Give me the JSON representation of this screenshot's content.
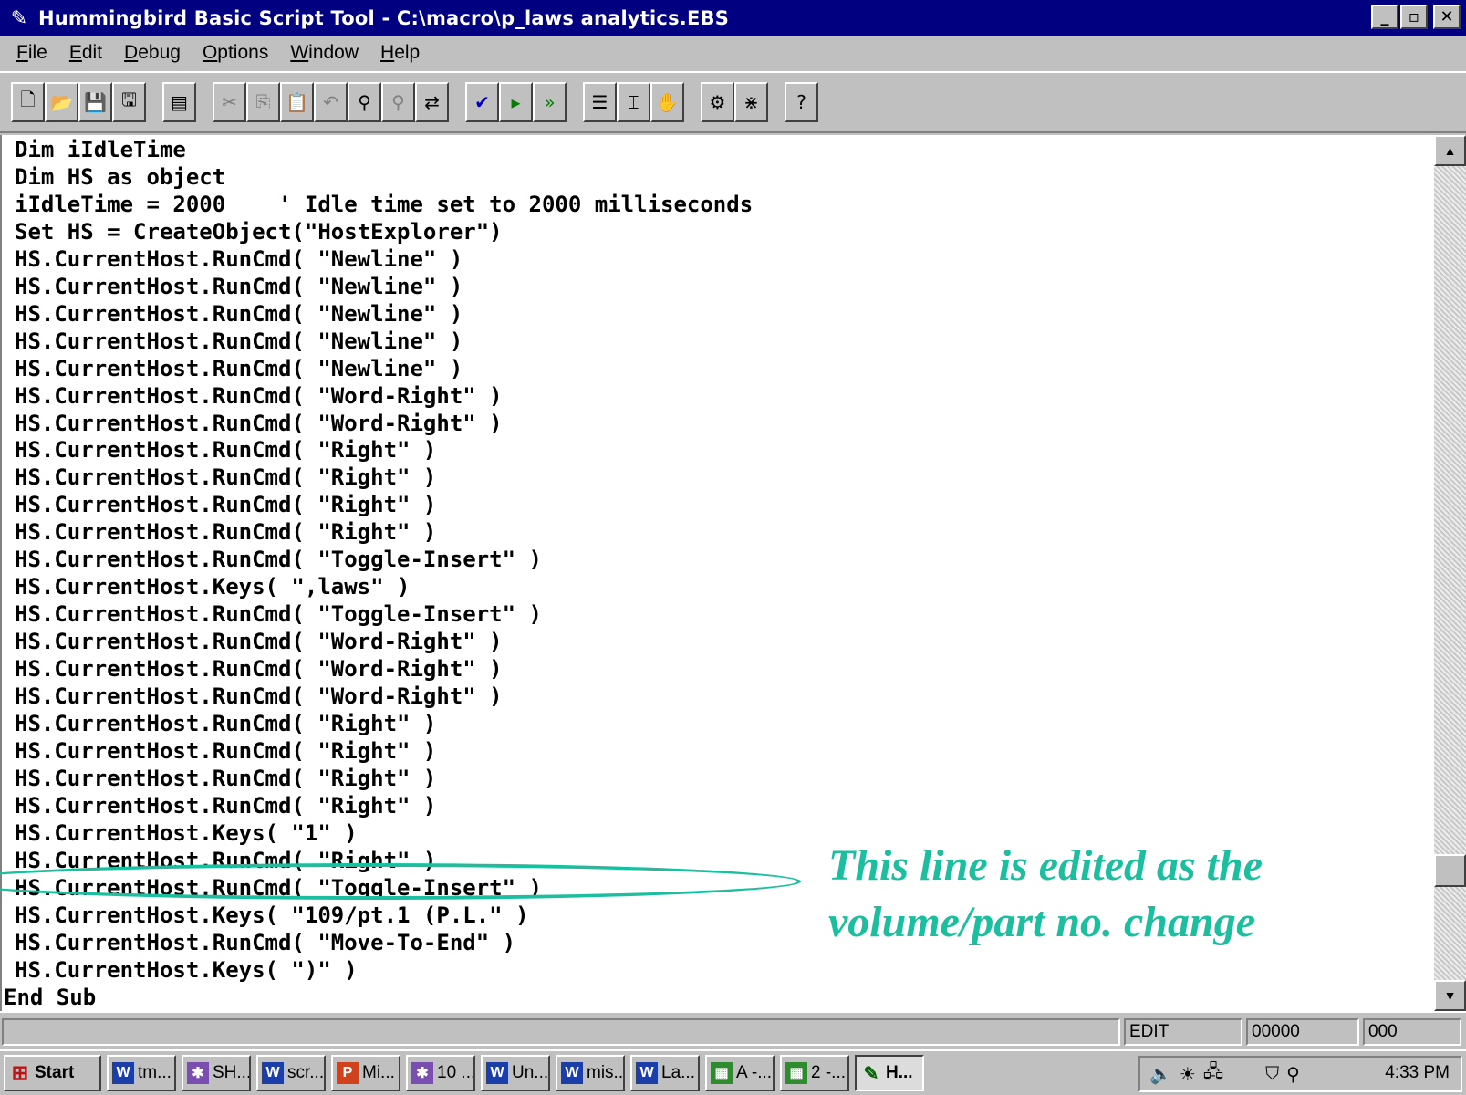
{
  "window": {
    "title": "Hummingbird Basic Script Tool - C:\\macro\\p_laws analytics.EBS",
    "buttons": {
      "minimize": "_",
      "maximize": "▫",
      "close": "✕"
    }
  },
  "menu": [
    {
      "u": "F",
      "rest": "ile"
    },
    {
      "u": "E",
      "rest": "dit"
    },
    {
      "u": "D",
      "rest": "ebug"
    },
    {
      "u": "O",
      "rest": "ptions"
    },
    {
      "u": "W",
      "rest": "indow"
    },
    {
      "u": "H",
      "rest": "elp"
    }
  ],
  "toolbar": {
    "icons": [
      "new-icon",
      "open-icon",
      "save-icon",
      "save-as-icon",
      "dialog-editor-icon",
      "cut-icon",
      "copy-icon",
      "paste-icon",
      "undo-icon",
      "find-icon",
      "find-next-icon",
      "replace-icon",
      "syntax-check-icon",
      "start-icon",
      "step-icon",
      "toggle-breakpoint-icon",
      "add-watch-icon",
      "hand-icon",
      "calls-icon",
      "quick-watch-icon",
      "help-icon"
    ]
  },
  "code": {
    "lines": [
      "Dim iIdleTime",
      "Dim HS as object",
      "iIdleTime = 2000    ' Idle time set to 2000 milliseconds",
      "Set HS = CreateObject(\"HostExplorer\")",
      "HS.CurrentHost.RunCmd( \"Newline\" )",
      "HS.CurrentHost.RunCmd( \"Newline\" )",
      "HS.CurrentHost.RunCmd( \"Newline\" )",
      "HS.CurrentHost.RunCmd( \"Newline\" )",
      "HS.CurrentHost.RunCmd( \"Newline\" )",
      "HS.CurrentHost.RunCmd( \"Word-Right\" )",
      "HS.CurrentHost.RunCmd( \"Word-Right\" )",
      "HS.CurrentHost.RunCmd( \"Right\" )",
      "HS.CurrentHost.RunCmd( \"Right\" )",
      "HS.CurrentHost.RunCmd( \"Right\" )",
      "HS.CurrentHost.RunCmd( \"Right\" )",
      "HS.CurrentHost.RunCmd( \"Toggle-Insert\" )",
      "HS.CurrentHost.Keys( \",laws\" )",
      "HS.CurrentHost.RunCmd( \"Toggle-Insert\" )",
      "HS.CurrentHost.RunCmd( \"Word-Right\" )",
      "HS.CurrentHost.RunCmd( \"Word-Right\" )",
      "HS.CurrentHost.RunCmd( \"Word-Right\" )",
      "HS.CurrentHost.RunCmd( \"Right\" )",
      "HS.CurrentHost.RunCmd( \"Right\" )",
      "HS.CurrentHost.RunCmd( \"Right\" )",
      "HS.CurrentHost.RunCmd( \"Right\" )",
      "HS.CurrentHost.Keys( \"1\" )",
      "HS.CurrentHost.RunCmd( \"Right\" )",
      "HS.CurrentHost.RunCmd( \"Toggle-Insert\" )",
      "HS.CurrentHost.Keys( \"109/pt.1 (P.L.\" )",
      "HS.CurrentHost.RunCmd( \"Move-To-End\" )",
      "HS.CurrentHost.Keys( \")\" )",
      "End Sub"
    ]
  },
  "callout": {
    "text": "This line is edited as the volume/part no. change",
    "color": "#1bbf9f"
  },
  "status": {
    "mode": "EDIT",
    "line": "00000",
    "col": "000"
  },
  "taskbar": {
    "start_label": "Start",
    "items": [
      {
        "label": "tm...",
        "icon": "word"
      },
      {
        "label": "SH...",
        "icon": "multi"
      },
      {
        "label": "scr...",
        "icon": "word"
      },
      {
        "label": "Mi...",
        "icon": "ppt"
      },
      {
        "label": "10 ...",
        "icon": "multi"
      },
      {
        "label": "Un...",
        "icon": "word"
      },
      {
        "label": "mis...",
        "icon": "word"
      },
      {
        "label": "La...",
        "icon": "word"
      },
      {
        "label": "A -...",
        "icon": "green"
      },
      {
        "label": "2 -...",
        "icon": "green"
      },
      {
        "label": "H...",
        "icon": "hb",
        "active": true
      }
    ],
    "clock": "4:33 PM"
  },
  "colors": {
    "titlebar": "#000080",
    "chrome": "#c0c0c0",
    "editor_bg": "#ffffff",
    "accent": "#1bbf9f"
  }
}
